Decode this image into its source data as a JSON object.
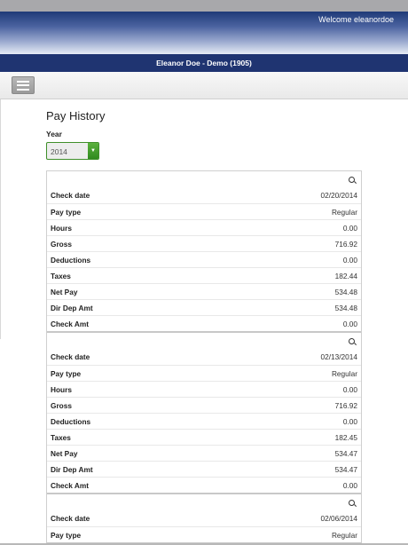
{
  "header": {
    "welcome": "Welcome eleanordoe"
  },
  "userbar": {
    "title": "Eleanor Doe - Demo (1905)"
  },
  "page": {
    "title": "Pay History",
    "year_label": "Year",
    "year_value": "2014"
  },
  "records": [
    {
      "rows": [
        {
          "label": "Check date",
          "value": "02/20/2014"
        },
        {
          "label": "Pay type",
          "value": "Regular"
        },
        {
          "label": "Hours",
          "value": "0.00"
        },
        {
          "label": "Gross",
          "value": "716.92"
        },
        {
          "label": "Deductions",
          "value": "0.00"
        },
        {
          "label": "Taxes",
          "value": "182.44"
        },
        {
          "label": "Net Pay",
          "value": "534.48"
        },
        {
          "label": "Dir Dep Amt",
          "value": "534.48"
        },
        {
          "label": "Check Amt",
          "value": "0.00"
        }
      ]
    },
    {
      "rows": [
        {
          "label": "Check date",
          "value": "02/13/2014"
        },
        {
          "label": "Pay type",
          "value": "Regular"
        },
        {
          "label": "Hours",
          "value": "0.00"
        },
        {
          "label": "Gross",
          "value": "716.92"
        },
        {
          "label": "Deductions",
          "value": "0.00"
        },
        {
          "label": "Taxes",
          "value": "182.45"
        },
        {
          "label": "Net Pay",
          "value": "534.47"
        },
        {
          "label": "Dir Dep Amt",
          "value": "534.47"
        },
        {
          "label": "Check Amt",
          "value": "0.00"
        }
      ]
    },
    {
      "rows": [
        {
          "label": "Check date",
          "value": "02/06/2014"
        },
        {
          "label": "Pay type",
          "value": "Regular"
        }
      ]
    }
  ]
}
